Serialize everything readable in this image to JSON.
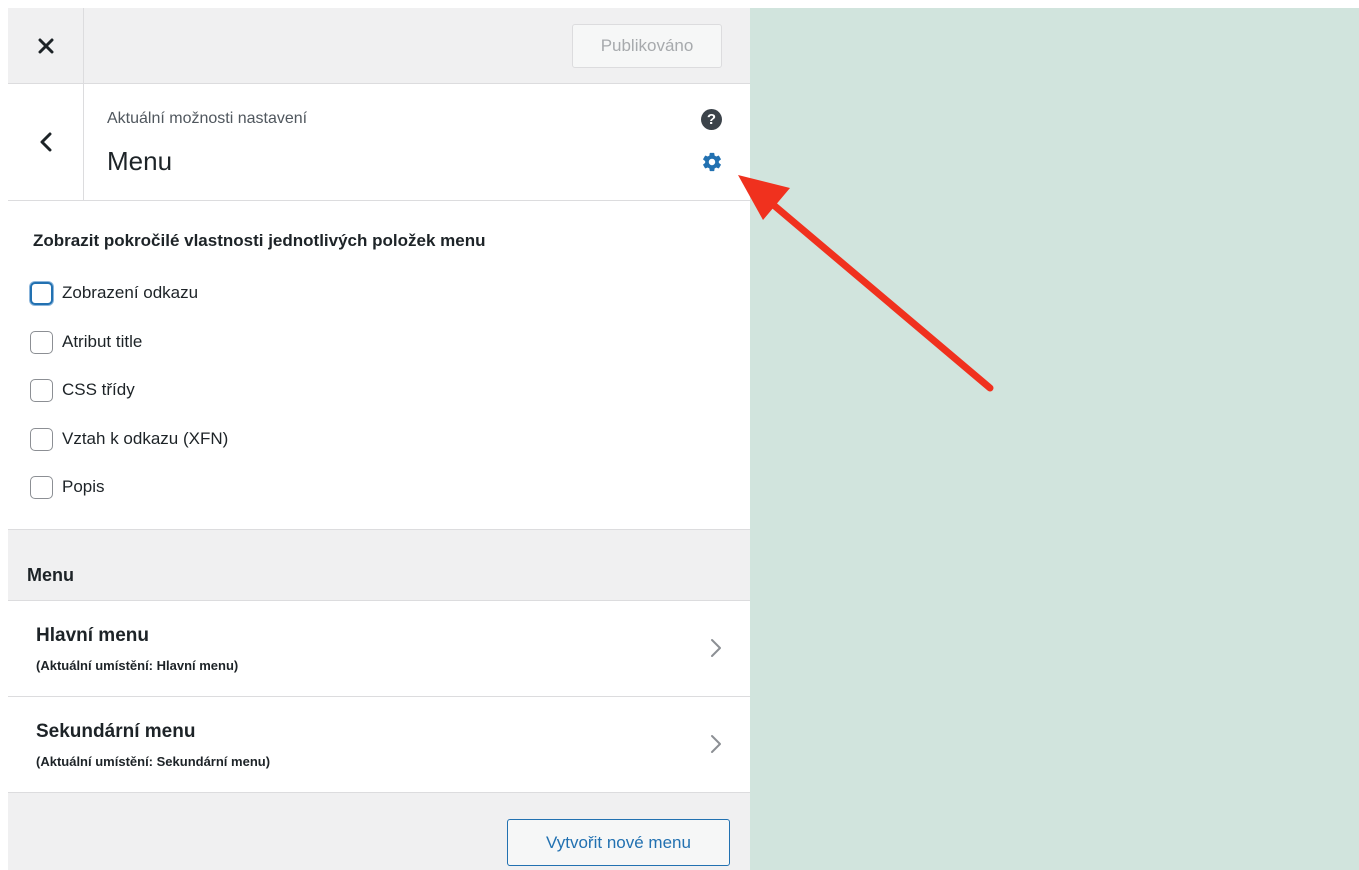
{
  "header": {
    "close_icon": "close-icon",
    "publish_label": "Publikováno"
  },
  "panel": {
    "subtitle": "Aktuální možnosti nastavení",
    "title": "Menu",
    "help_symbol": "?",
    "back_icon": "chevron-left-icon",
    "settings_icon": "gear-icon"
  },
  "options": {
    "heading": "Zobrazit pokročilé vlastnosti jednotlivých položek menu",
    "items": [
      {
        "label": "Zobrazení odkazu",
        "checked": false,
        "focused": true
      },
      {
        "label": "Atribut title",
        "checked": false,
        "focused": false
      },
      {
        "label": "CSS třídy",
        "checked": false,
        "focused": false
      },
      {
        "label": "Vztah k odkazu (XFN)",
        "checked": false,
        "focused": false
      },
      {
        "label": "Popis",
        "checked": false,
        "focused": false
      }
    ]
  },
  "menus": {
    "heading": "Menu",
    "items": [
      {
        "title": "Hlavní menu",
        "location": "(Aktuální umístění: Hlavní menu)"
      },
      {
        "title": "Sekundární menu",
        "location": "(Aktuální umístění: Sekundární menu)"
      }
    ],
    "create_label": "Vytvořit nové menu"
  },
  "colors": {
    "accent": "#2271b1",
    "preview_bg": "#d1e4dd",
    "annotation_arrow": "#f0311e"
  }
}
